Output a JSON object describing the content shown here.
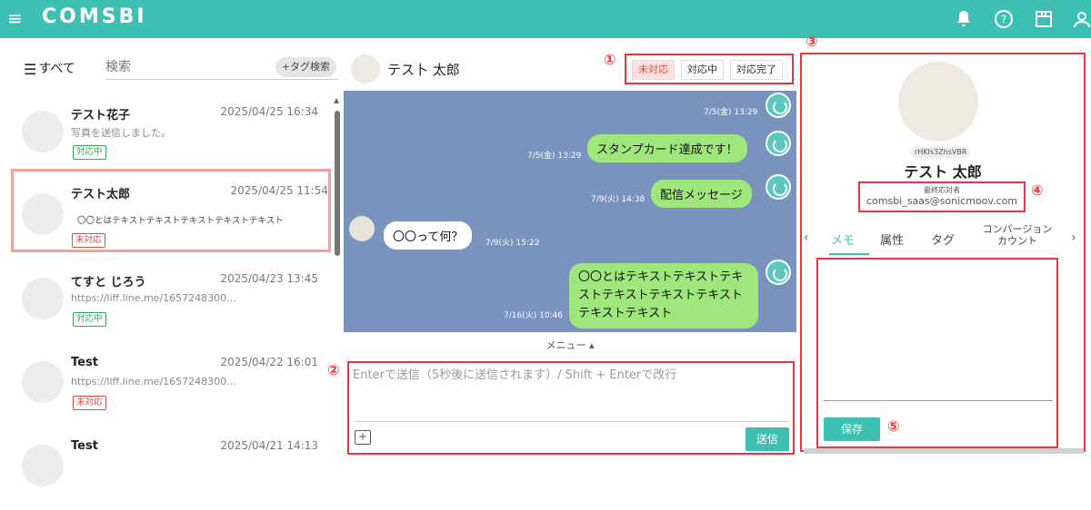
{
  "app": {
    "logo": "COMSBI"
  },
  "list": {
    "filter_label": "すべて",
    "search_placeholder": "検索",
    "tag_search": "+タグ検索",
    "items": [
      {
        "name": "テスト花子",
        "time": "2025/04/25 16:34",
        "preview": "写真を送信しました。",
        "badge": "対応中"
      },
      {
        "name": "テスト太郎",
        "time": "2025/04/25 11:54",
        "preview": "〇〇とはテキストテキストテキストテキストテキスト",
        "badge": "未対応"
      },
      {
        "name": "てすと じろう",
        "time": "2025/04/23 13:45",
        "preview": "https://liff.line.me/1657248300...",
        "badge": "対応中"
      },
      {
        "name": "Test",
        "time": "2025/04/22 16:01",
        "preview": "https://liff.line.me/1657248300...",
        "badge": "未対応"
      },
      {
        "name": "Test",
        "time": "2025/04/21 14:13",
        "preview": "",
        "badge": ""
      }
    ]
  },
  "chat": {
    "contact_name": "テス卜 太郎",
    "status_buttons": [
      "未対応",
      "対応中",
      "対応完了"
    ],
    "messages": [
      {
        "text": "",
        "time": "7/5(金) 13:29"
      },
      {
        "text": "スタンプカード達成です！",
        "time": "7/5(金) 13:29"
      },
      {
        "text": "配信メッセージ",
        "time": "7/9(火) 14:38"
      },
      {
        "text": "〇〇って何？",
        "time": "7/9(火) 15:22"
      },
      {
        "text": "〇〇とはテキストテキストテキストテキストテキストテキストテキストテキスト",
        "time": "7/16(火) 10:46"
      }
    ],
    "menu_label": "メニュー ▴",
    "input_placeholder": "Enterで送信（5秒後に送信されます）/ Shift + Enterで改行",
    "send_label": "送信"
  },
  "profile": {
    "id_tag": "rHKIs3ZhsVBR",
    "name": "テスト 太郎",
    "operator_label": "最終応対者",
    "operator_email": "comsbi_saas@sonicmoov.com",
    "tabs": [
      "メモ",
      "属性",
      "タグ",
      "コンバージョン カウント"
    ],
    "save_label": "保存"
  },
  "annotations": [
    "①",
    "②",
    "③",
    "④",
    "⑤"
  ],
  "colors": {
    "brand": "#3dbfb3",
    "highlight": "#e7373e",
    "chat_bg": "#7a93be",
    "bubble_green": "#9fe67d"
  }
}
